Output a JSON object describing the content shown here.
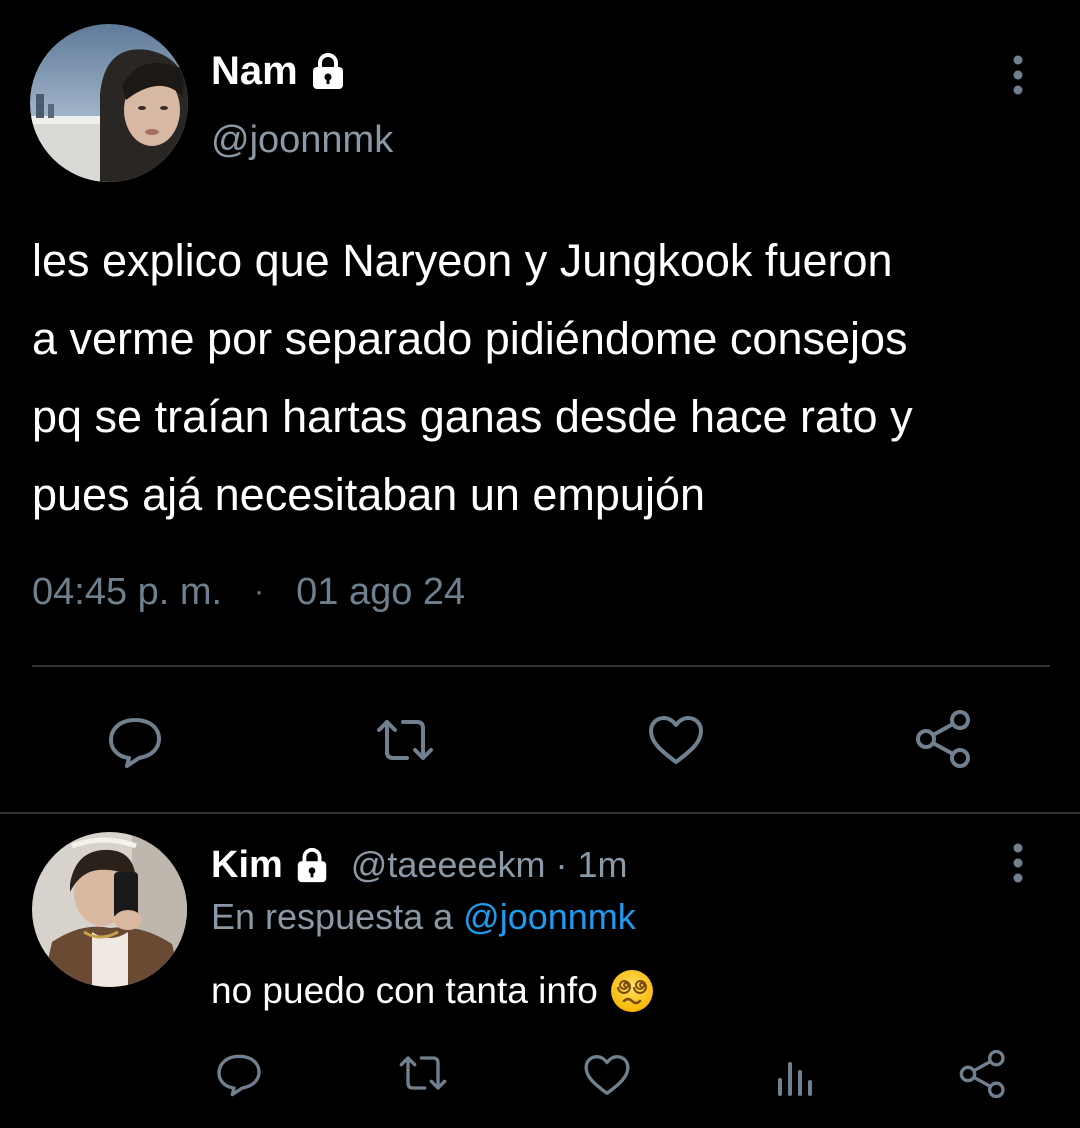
{
  "main_tweet": {
    "author": {
      "display_name": "Nam",
      "handle": "@joonnmk",
      "protected_icon": "lock-icon"
    },
    "text": "les explico que Naryeon y Jungkook fueron\na verme por separado pidiéndome consejos\npq se traían hartas ganas desde hace rato y\npues ajá necesitaban un empujón",
    "time": "04:45 p. m.",
    "separator": "·",
    "date": "01 ago 24",
    "actions": [
      "reply-icon",
      "retweet-icon",
      "like-icon",
      "share-icon"
    ]
  },
  "reply": {
    "author": {
      "display_name": "Kim",
      "handle": "@taeeeekm",
      "protected_icon": "lock-icon"
    },
    "separator": "·",
    "time": "1m",
    "reply_to_label": "En respuesta a",
    "reply_to_handle": "@joonnmk",
    "text": "no puedo con tanta info",
    "emoji": "dizzy-face-emoji",
    "actions": [
      "reply-icon",
      "retweet-icon",
      "like-icon",
      "views-icon",
      "share-icon"
    ]
  },
  "colors": {
    "background": "#000000",
    "text_primary": "#ffffff",
    "text_secondary": "#8b98a5",
    "icon": "#71808e",
    "link": "#1d9bf0",
    "divider": "#2f3336"
  }
}
